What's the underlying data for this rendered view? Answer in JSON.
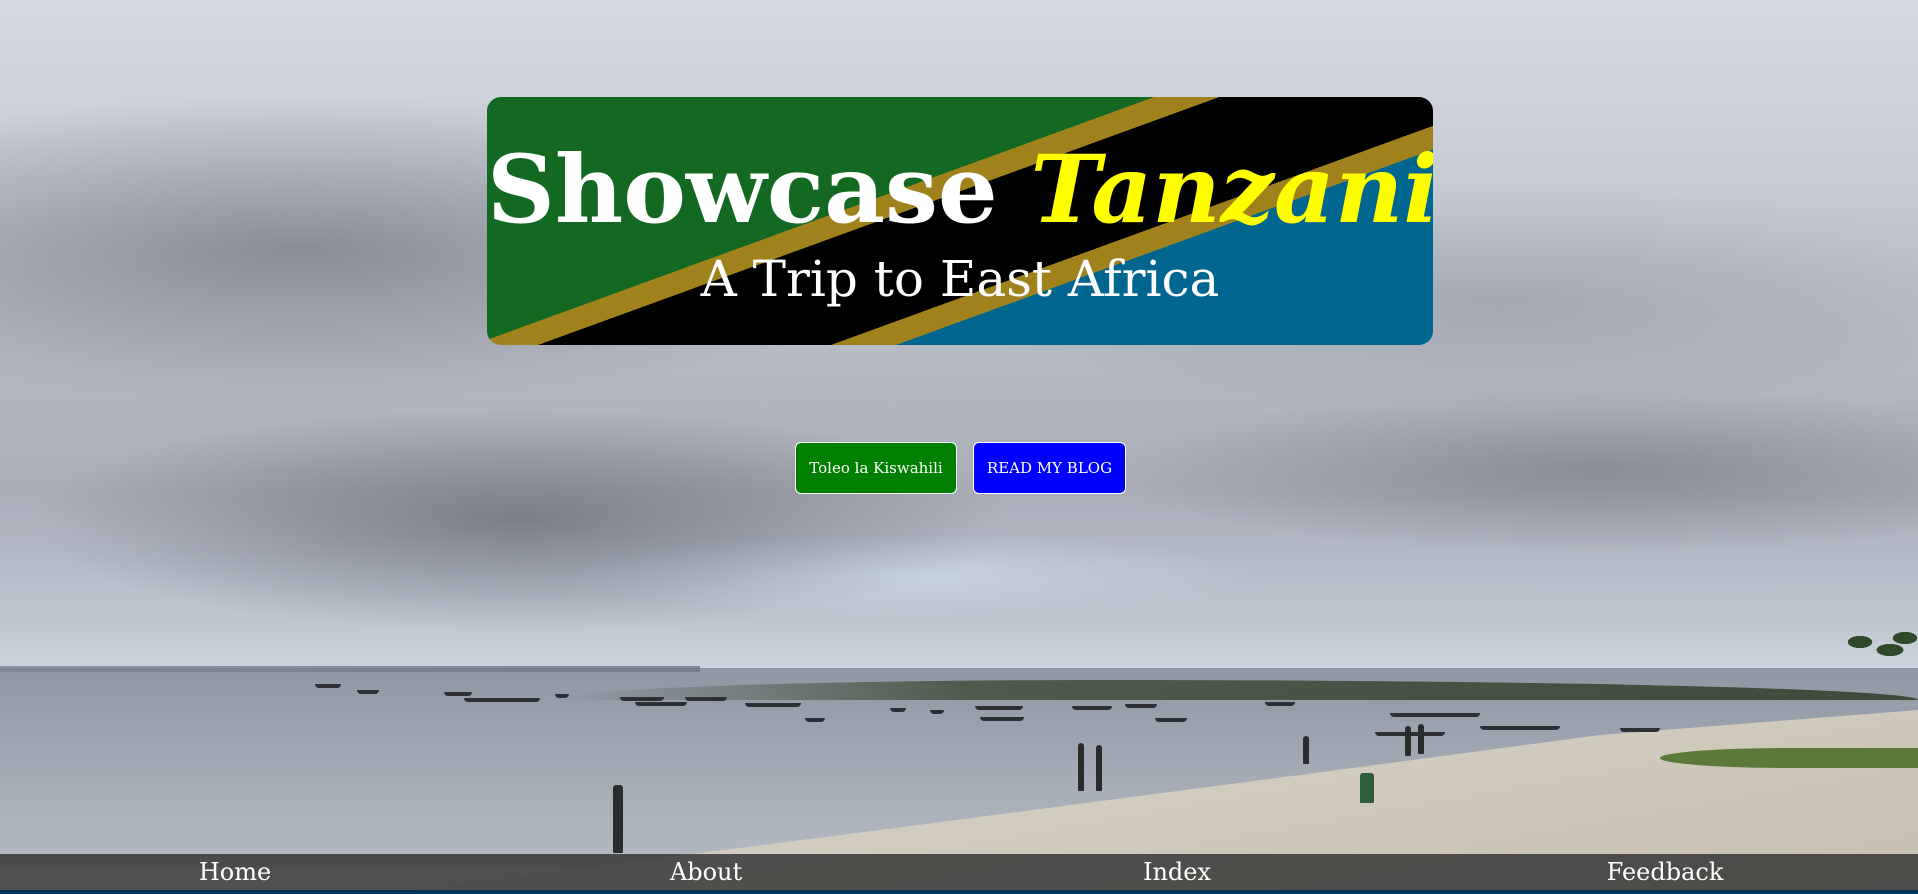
{
  "banner": {
    "title_main": "Showcase",
    "title_accent": "Tanzania",
    "subtitle": "A Trip to East Africa",
    "colors": {
      "green": "#136822",
      "gold": "#a0821c",
      "black": "#000000",
      "blue": "#00658f",
      "accent_text": "#ffff00"
    }
  },
  "buttons": {
    "swahili_label": "Toleo la Kiswahili",
    "blog_label": "READ MY BLOG",
    "colors": {
      "swahili": "#008000",
      "blog": "#0000ff"
    }
  },
  "nav": {
    "items": [
      {
        "label": "Home"
      },
      {
        "label": "About"
      },
      {
        "label": "Index"
      },
      {
        "label": "Feedback"
      }
    ]
  },
  "background": {
    "icon": "beach-photo"
  }
}
